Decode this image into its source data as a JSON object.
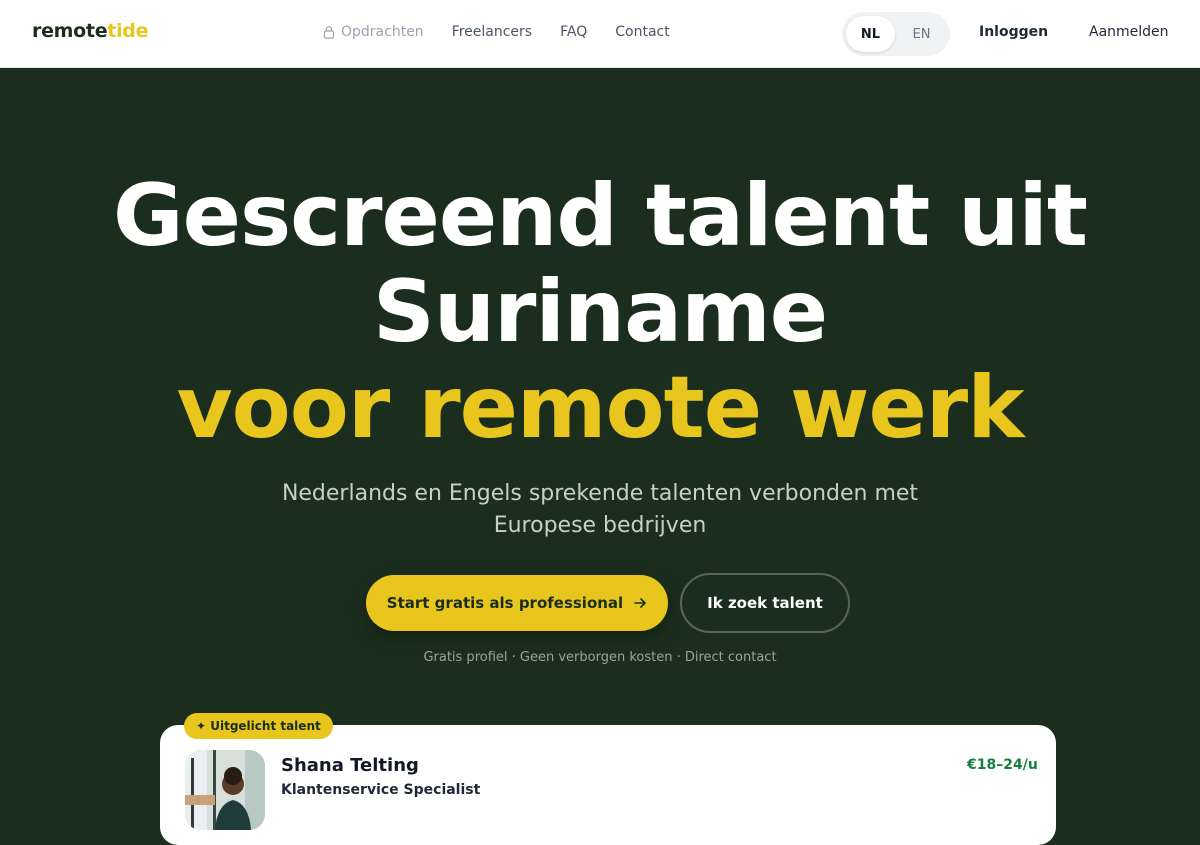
{
  "brand": {
    "part1": "remote",
    "part2": "tide"
  },
  "nav": {
    "items": [
      {
        "label": "Opdrachten",
        "locked": true
      },
      {
        "label": "Freelancers"
      },
      {
        "label": "FAQ"
      },
      {
        "label": "Contact"
      }
    ]
  },
  "lang": {
    "nl": "NL",
    "en": "EN",
    "active": "NL"
  },
  "auth": {
    "login": "Inloggen",
    "signup": "Aanmelden"
  },
  "hero": {
    "title_line1": "Gescreend talent uit",
    "title_line2": "Suriname",
    "title_accent": "voor remote werk",
    "subtitle": "Nederlands en Engels sprekende talenten verbonden met Europese bedrijven",
    "cta_primary": "Start gratis als professional",
    "cta_secondary": "Ik zoek talent",
    "note": "Gratis profiel · Geen verborgen kosten · Direct contact"
  },
  "featured": {
    "badge": "✦ Uitgelicht talent",
    "name": "Shana Telting",
    "role": "Klantenservice Specialist",
    "rate": "€18–24/u"
  },
  "colors": {
    "hero_bg": "#1b2e1d",
    "accent": "#e9c61d",
    "rate": "#15803d"
  }
}
